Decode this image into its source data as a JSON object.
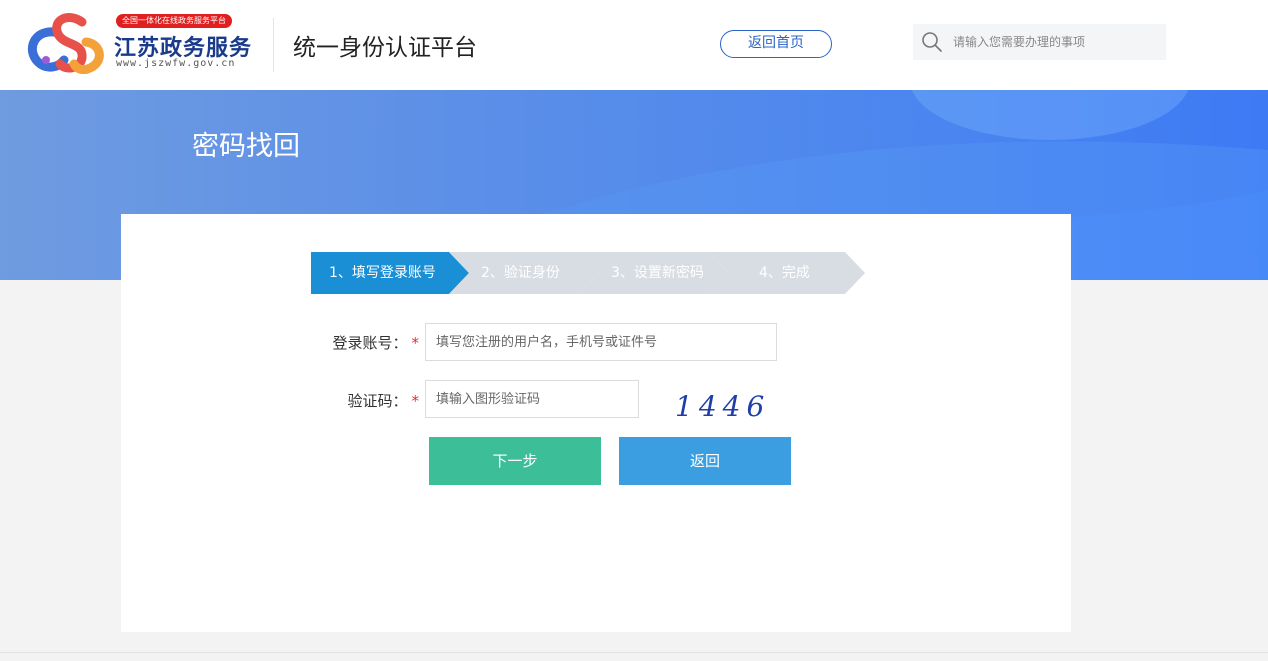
{
  "header": {
    "badge": "全国一体化在线政务服务平台",
    "brand_name": "江苏政务服务",
    "brand_url": "www.jszwfw.gov.cn",
    "platform_title": "统一身份认证平台",
    "home_button": "返回首页",
    "search_placeholder": "请输入您需要办理的事项",
    "search_icon": "search-icon"
  },
  "banner": {
    "title": "密码找回"
  },
  "steps": [
    {
      "label": "1、填写登录账号",
      "active": true
    },
    {
      "label": "2、验证身份",
      "active": false
    },
    {
      "label": "3、设置新密码",
      "active": false
    },
    {
      "label": "4、完成",
      "active": false
    }
  ],
  "form": {
    "account_label": "登录账号：",
    "account_placeholder": "填写您注册的用户名，手机号或证件号",
    "captcha_label": "验证码：",
    "captcha_placeholder": "填输入图形验证码",
    "required_mark": "*",
    "captcha_text": "1446",
    "next_button": "下一步",
    "back_button": "返回"
  },
  "colors": {
    "brand_blue": "#1a3a8c",
    "active_step": "#1a8fd6",
    "inactive_step": "#d8dde3",
    "next_button": "#3cbf98",
    "back_button": "#3a9ee0",
    "required": "#e03030"
  }
}
